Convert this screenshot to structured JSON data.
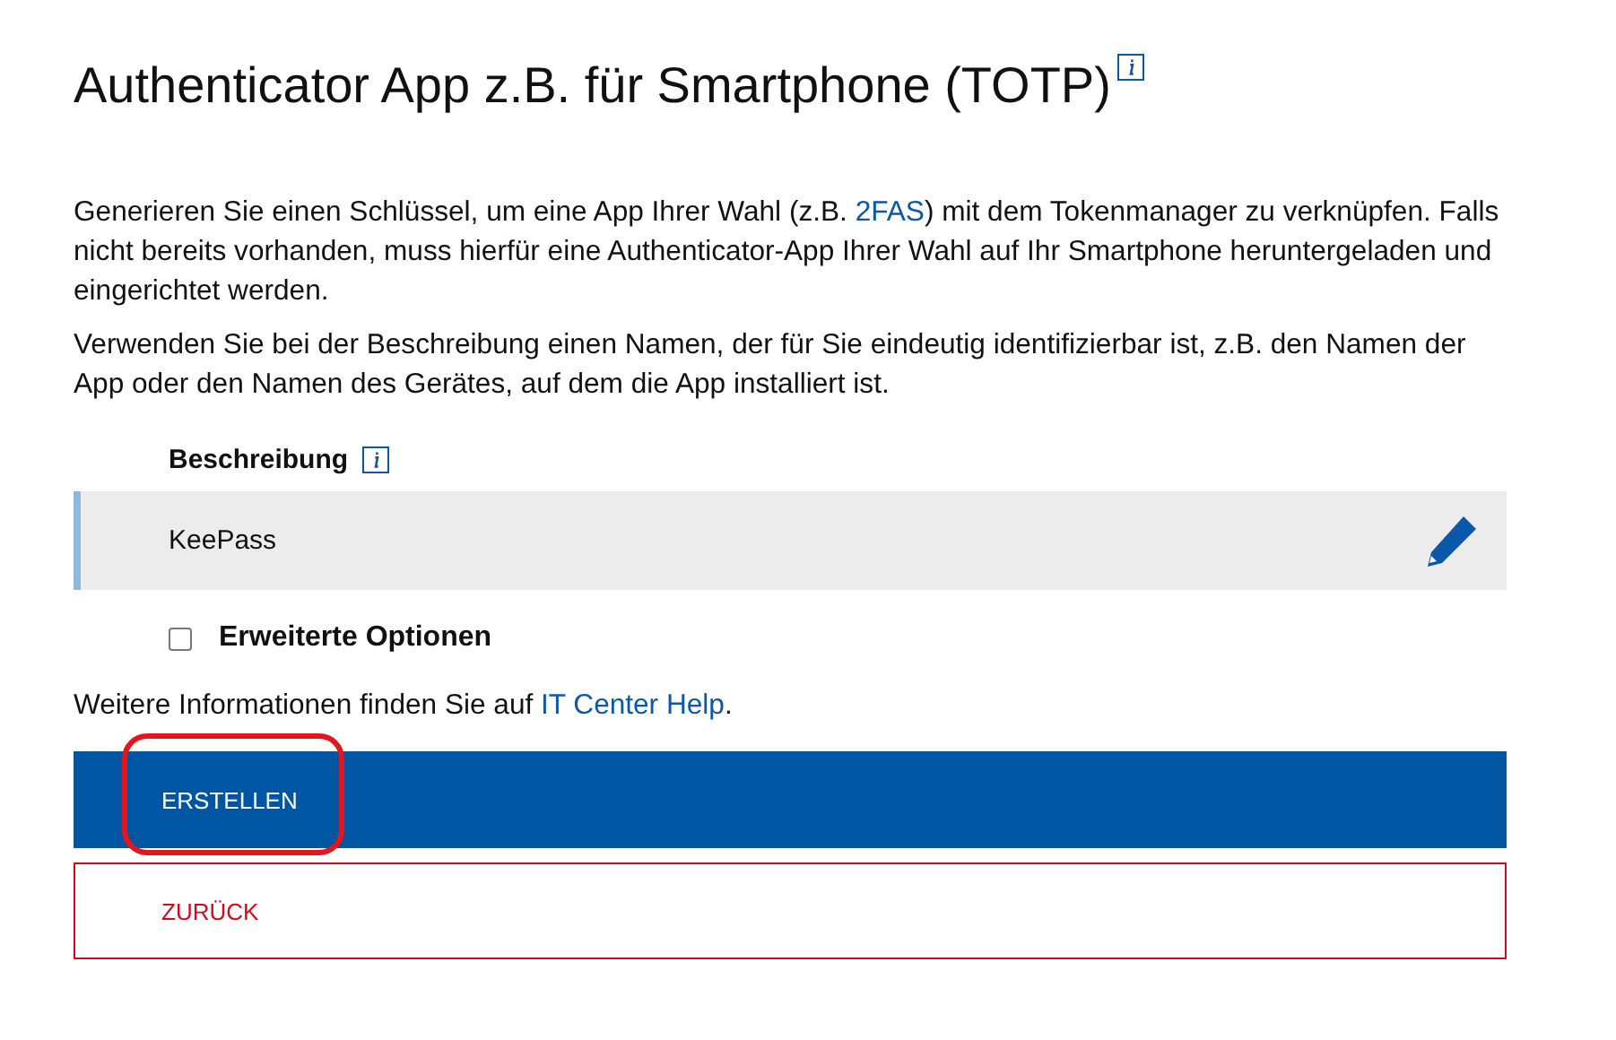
{
  "title": "Authenticator App z.B. für Smartphone (TOTP)",
  "intro": [
    {
      "segments": [
        {
          "kind": "text",
          "text": "Generieren Sie einen Schlüssel, um eine App Ihrer Wahl (z.B. "
        },
        {
          "kind": "link",
          "text": "2FAS"
        },
        {
          "kind": "text",
          "text": ") mit dem Tokenmanager zu verknüpfen. Falls nicht bereits vorhanden, muss hierfür eine Authenticator-App Ihrer Wahl auf Ihr Smartphone heruntergeladen und eingerichtet werden."
        }
      ]
    },
    {
      "segments": [
        {
          "kind": "text",
          "text": "Verwenden Sie bei der Beschreibung einen Namen, der für Sie eindeutig identifizierbar ist, z.B. den Namen der App oder den Namen des Gerätes, auf dem die App installiert ist."
        }
      ]
    }
  ],
  "description_field": {
    "label": "Beschreibung",
    "value": "KeePass"
  },
  "advanced_options": {
    "label": "Erweiterte Optionen",
    "checked": false
  },
  "more_info": {
    "segments": [
      {
        "kind": "text",
        "text": "Weitere Informationen finden Sie auf "
      },
      {
        "kind": "link",
        "text": "IT Center Help"
      },
      {
        "kind": "text",
        "text": "."
      }
    ]
  },
  "buttons": [
    {
      "label": "ERSTELLEN",
      "kind": "primary",
      "highlighted": true
    },
    {
      "label": "ZURÜCK",
      "kind": "secondary",
      "highlighted": false
    }
  ]
}
